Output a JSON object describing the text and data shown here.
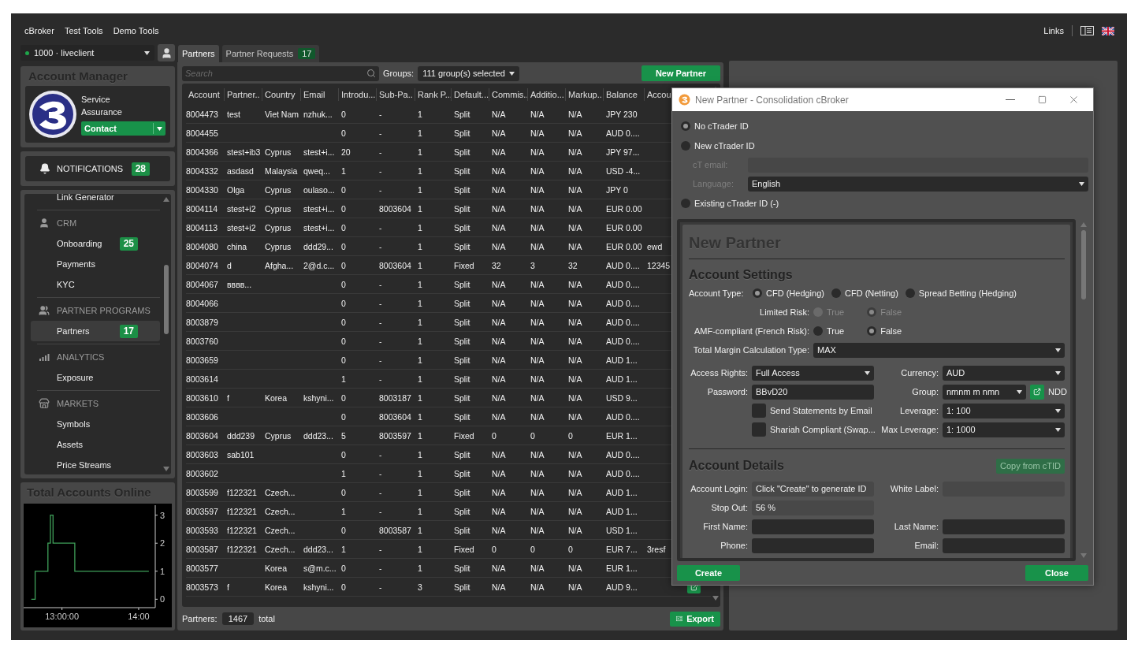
{
  "menu": [
    {
      "label": "cBroker"
    },
    {
      "label": "Test Tools"
    },
    {
      "label": "Demo Tools"
    }
  ],
  "top_right": {
    "links": "Links"
  },
  "account_select": {
    "value": "1000 · liveclient",
    "online": true
  },
  "account_manager": {
    "title": "Account Manager",
    "name": "Service Assurance",
    "contact": "Contact"
  },
  "notifications": {
    "label": "NOTIFICATIONS",
    "count": "28"
  },
  "nav": {
    "top_items": [
      {
        "label": "Link Generator",
        "selected": false
      }
    ],
    "sections": [
      {
        "label": "CRM",
        "items": [
          {
            "label": "Onboarding",
            "badge": "25",
            "selected": false
          },
          {
            "label": "Payments",
            "selected": false
          },
          {
            "label": "KYC",
            "selected": false
          }
        ]
      },
      {
        "label": "PARTNER PROGRAMS",
        "items": [
          {
            "label": "Partners",
            "badge": "17",
            "selected": true
          }
        ]
      },
      {
        "label": "ANALYTICS",
        "items": [
          {
            "label": "Exposure",
            "selected": false
          }
        ]
      },
      {
        "label": "MARKETS",
        "items": [
          {
            "label": "Symbols",
            "selected": false
          },
          {
            "label": "Assets",
            "selected": false
          },
          {
            "label": "Price Streams",
            "selected": false
          }
        ]
      }
    ]
  },
  "accounts_chart": {
    "title": "Total Accounts Online",
    "chart_data": {
      "type": "line",
      "x": [
        756,
        759,
        759,
        769,
        769,
        771,
        771,
        773,
        773,
        790,
        790,
        848
      ],
      "series": [
        {
          "color": "#3fa05a",
          "values": [
            0,
            0,
            1,
            1,
            2,
            2,
            3,
            3,
            2,
            2,
            1,
            1
          ]
        }
      ],
      "xlim": [
        750,
        853
      ],
      "ylim": [
        -0.3,
        3.3
      ],
      "xticks": [
        {
          "value": 780,
          "label": "13:00:00"
        },
        {
          "value": 840,
          "label": "14:00"
        }
      ],
      "yticks": [
        0,
        1,
        2,
        3
      ]
    }
  },
  "tabs": [
    {
      "label": "Partners",
      "selected": true
    },
    {
      "label": "Partner Requests",
      "selected": false,
      "badge": "17"
    }
  ],
  "toolbar": {
    "search": {
      "placeholder": "Search"
    },
    "groups_label": "Groups:",
    "groups_value": "111 group(s) selected",
    "new_button": "New Partner"
  },
  "table": {
    "columns": [
      {
        "label": "Account"
      },
      {
        "label": "Partner.."
      },
      {
        "label": "Country"
      },
      {
        "label": "Email"
      },
      {
        "label": "Introdu..."
      },
      {
        "label": "Sub-Pa.."
      },
      {
        "label": "Rank P..."
      },
      {
        "label": "Default..."
      },
      {
        "label": "Commis.."
      },
      {
        "label": "Additio..."
      },
      {
        "label": "Markup.."
      },
      {
        "label": "Balance"
      },
      {
        "label": "Accou"
      }
    ],
    "rows": [
      {
        "cells": [
          "8004473",
          "test",
          "Viet Nam",
          "nzhuk...",
          "0",
          "-",
          "1",
          "Split",
          "N/A",
          "N/A",
          "N/A",
          "JPY 230",
          null
        ]
      },
      {
        "cells": [
          "8004455",
          null,
          null,
          null,
          "0",
          "-",
          "1",
          "Split",
          "N/A",
          "N/A",
          "N/A",
          "AUD 0....",
          null
        ]
      },
      {
        "cells": [
          "8004366",
          "stest+ib3",
          "Cyprus",
          "stest+i...",
          "20",
          "-",
          "1",
          "Split",
          "N/A",
          "N/A",
          "N/A",
          "JPY 97...",
          null
        ]
      },
      {
        "cells": [
          "8004332",
          "asdasd",
          "Malaysia",
          "qweq...",
          "1",
          "-",
          "1",
          "Split",
          "N/A",
          "N/A",
          "N/A",
          "USD -4...",
          null
        ]
      },
      {
        "cells": [
          "8004330",
          "Olga",
          "Cyprus",
          "oulaso...",
          "0",
          "-",
          "1",
          "Split",
          "N/A",
          "N/A",
          "N/A",
          "JPY 0",
          null
        ]
      },
      {
        "cells": [
          "8004114",
          "stest+i2",
          "Cyprus",
          "stest+i...",
          "0",
          "8003604",
          "1",
          "Split",
          "N/A",
          "N/A",
          "N/A",
          "EUR 0.00",
          null
        ]
      },
      {
        "cells": [
          "8004113",
          "stest+i2",
          "Cyprus",
          "stest+i...",
          "0",
          "-",
          "1",
          "Split",
          "N/A",
          "N/A",
          "N/A",
          "EUR 0.00",
          null
        ]
      },
      {
        "cells": [
          "8004080",
          "china",
          "Cyprus",
          "ddd29...",
          "0",
          "-",
          "1",
          "Split",
          "N/A",
          "N/A",
          "N/A",
          "EUR 0.00",
          "ewd"
        ]
      },
      {
        "cells": [
          "8004074",
          "d",
          "Afgha...",
          "2@d.c...",
          "0",
          "8003604",
          "1",
          "Fixed",
          "32",
          "3",
          "32",
          "AUD 0....",
          "12345"
        ]
      },
      {
        "cells": [
          "8004067",
          "вввв...",
          null,
          null,
          "0",
          "-",
          "1",
          "Split",
          "N/A",
          "N/A",
          "N/A",
          "AUD 0....",
          null
        ]
      },
      {
        "cells": [
          "8004066",
          null,
          null,
          null,
          "0",
          "-",
          "1",
          "Split",
          "N/A",
          "N/A",
          "N/A",
          "AUD 0....",
          null
        ]
      },
      {
        "cells": [
          "8003879",
          null,
          null,
          null,
          "0",
          "-",
          "1",
          "Split",
          "N/A",
          "N/A",
          "N/A",
          "AUD 0....",
          null
        ]
      },
      {
        "cells": [
          "8003760",
          null,
          null,
          null,
          "0",
          "-",
          "1",
          "Split",
          "N/A",
          "N/A",
          "N/A",
          "AUD 0....",
          null
        ]
      },
      {
        "cells": [
          "8003659",
          null,
          null,
          null,
          "0",
          "-",
          "1",
          "Split",
          "N/A",
          "N/A",
          "N/A",
          "AUD 1...",
          null
        ]
      },
      {
        "cells": [
          "8003614",
          null,
          null,
          null,
          "1",
          "-",
          "1",
          "Split",
          "N/A",
          "N/A",
          "N/A",
          "AUD 1...",
          null
        ]
      },
      {
        "cells": [
          "8003610",
          "f",
          "Korea",
          "kshyni...",
          "0",
          "8003187",
          "1",
          "Split",
          "N/A",
          "N/A",
          "N/A",
          "USD 9...",
          null
        ]
      },
      {
        "cells": [
          "8003606",
          null,
          null,
          null,
          "0",
          "8003604",
          "1",
          "Split",
          "N/A",
          "N/A",
          "N/A",
          "AUD 0....",
          null
        ]
      },
      {
        "cells": [
          "8003604",
          "ddd239",
          "Cyprus",
          "ddd23...",
          "5",
          "8003597",
          "1",
          "Fixed",
          "0",
          "0",
          "0",
          "EUR 1...",
          null
        ]
      },
      {
        "cells": [
          "8003603",
          "sab101",
          null,
          null,
          "0",
          "-",
          "1",
          "Split",
          "N/A",
          "N/A",
          "N/A",
          "AUD 0....",
          null
        ]
      },
      {
        "cells": [
          "8003602",
          null,
          null,
          null,
          "1",
          "-",
          "1",
          "Split",
          "N/A",
          "N/A",
          "N/A",
          "AUD 0....",
          null
        ]
      },
      {
        "cells": [
          "8003599",
          "f122321",
          "Czech...",
          null,
          "0",
          "-",
          "1",
          "Split",
          "N/A",
          "N/A",
          "N/A",
          "AUD 1...",
          null
        ]
      },
      {
        "cells": [
          "8003597",
          "f122321",
          "Czech...",
          null,
          "1",
          "-",
          "1",
          "Split",
          "N/A",
          "N/A",
          "N/A",
          "AUD 1...",
          null
        ]
      },
      {
        "cells": [
          "8003593",
          "f122321",
          "Czech...",
          null,
          "0",
          "8003587",
          "1",
          "Split",
          "N/A",
          "N/A",
          "N/A",
          "USD 1...",
          null
        ]
      },
      {
        "cells": [
          "8003587",
          "f122321",
          "Czech...",
          "ddd23...",
          "1",
          "-",
          "1",
          "Fixed",
          "0",
          "0",
          "0",
          "EUR 7...",
          "3resf"
        ]
      },
      {
        "cells": [
          "8003577",
          null,
          "Korea",
          "s@m.c...",
          "0",
          "-",
          "1",
          "Split",
          "N/A",
          "N/A",
          "N/A",
          "EUR 1...",
          null
        ]
      },
      {
        "cells": [
          "8003573",
          "f",
          "Korea",
          "kshyni...",
          "0",
          "-",
          "3",
          "Split",
          "N/A",
          "N/A",
          "N/A",
          "AUD 9...",
          null
        ],
        "edit_button": true
      }
    ]
  },
  "footer": {
    "label": "Partners:",
    "count": "1467",
    "suffix": "total",
    "export": "Export"
  },
  "dialog": {
    "title": "New Partner - Consolidation cBroker",
    "id_options": [
      {
        "label": "No cTrader ID",
        "selected": true
      },
      {
        "label": "New cTrader ID",
        "selected": false
      },
      {
        "label": "Existing cTrader ID (-)",
        "selected": false
      }
    ],
    "ct_email": {
      "label": "cT email:",
      "disabled": true
    },
    "language": {
      "label": "Language:",
      "value": "English",
      "disabled": true
    },
    "heading": "New Partner",
    "settings_title": "Account Settings",
    "account_type": {
      "label": "Account Type:",
      "options": [
        {
          "label": "CFD (Hedging)",
          "selected": true
        },
        {
          "label": "CFD (Netting)",
          "selected": false
        },
        {
          "label": "Spread Betting (Hedging)",
          "selected": false
        }
      ]
    },
    "limited_risk": {
      "label": "Limited Risk:",
      "disabled": true,
      "options": [
        {
          "label": "True",
          "selected": false
        },
        {
          "label": "False",
          "selected": true
        }
      ]
    },
    "amf": {
      "label": "AMF-compliant (French Risk):",
      "disabled": false,
      "options": [
        {
          "label": "True",
          "selected": false
        },
        {
          "label": "False",
          "selected": true
        }
      ]
    },
    "margin_type": {
      "label": "Total Margin Calculation Type:",
      "value": "MAX"
    },
    "settings_rows": [
      {
        "cells": [
          {
            "kind": "select",
            "label": "Access Rights:",
            "value": "Full Access"
          },
          {
            "kind": "select",
            "label": "Currency:",
            "value": "AUD"
          }
        ]
      },
      {
        "cells": [
          {
            "kind": "input",
            "label": "Password:",
            "value": "BBvD20"
          },
          {
            "kind": "group",
            "label": "Group:",
            "value": "nmnm m nmn",
            "tag": "NDD"
          }
        ]
      },
      {
        "cells": [
          {
            "kind": "checkbox",
            "label": "Send Statements by Email",
            "checked": false
          },
          {
            "kind": "select",
            "label": "Leverage:",
            "value": "1: 100"
          }
        ]
      },
      {
        "cells": [
          {
            "kind": "checkbox",
            "label": "Shariah Compliant (Swap...",
            "checked": false
          },
          {
            "kind": "select",
            "label": "Max Leverage:",
            "value": "1: 1000"
          }
        ]
      }
    ],
    "details_title": "Account Details",
    "copy_button": {
      "label": "Copy from cTID",
      "disabled": true
    },
    "details_rows": [
      {
        "cells": [
          {
            "label": "Account Login:",
            "value": "Click \"Create\" to generate ID",
            "readonly": true
          },
          {
            "label": "White Label:",
            "readonly": true
          }
        ]
      },
      {
        "cells": [
          {
            "label": "Stop Out:",
            "value": "56 %",
            "readonly": true
          }
        ]
      },
      {
        "cells": [
          {
            "label": "First Name:",
            "readonly": false
          },
          {
            "label": "Last Name:",
            "readonly": false
          }
        ]
      },
      {
        "cells": [
          {
            "label": "Phone:",
            "readonly": false
          },
          {
            "label": "Email:",
            "readonly": false
          }
        ]
      }
    ],
    "create": "Create",
    "close": "Close"
  }
}
